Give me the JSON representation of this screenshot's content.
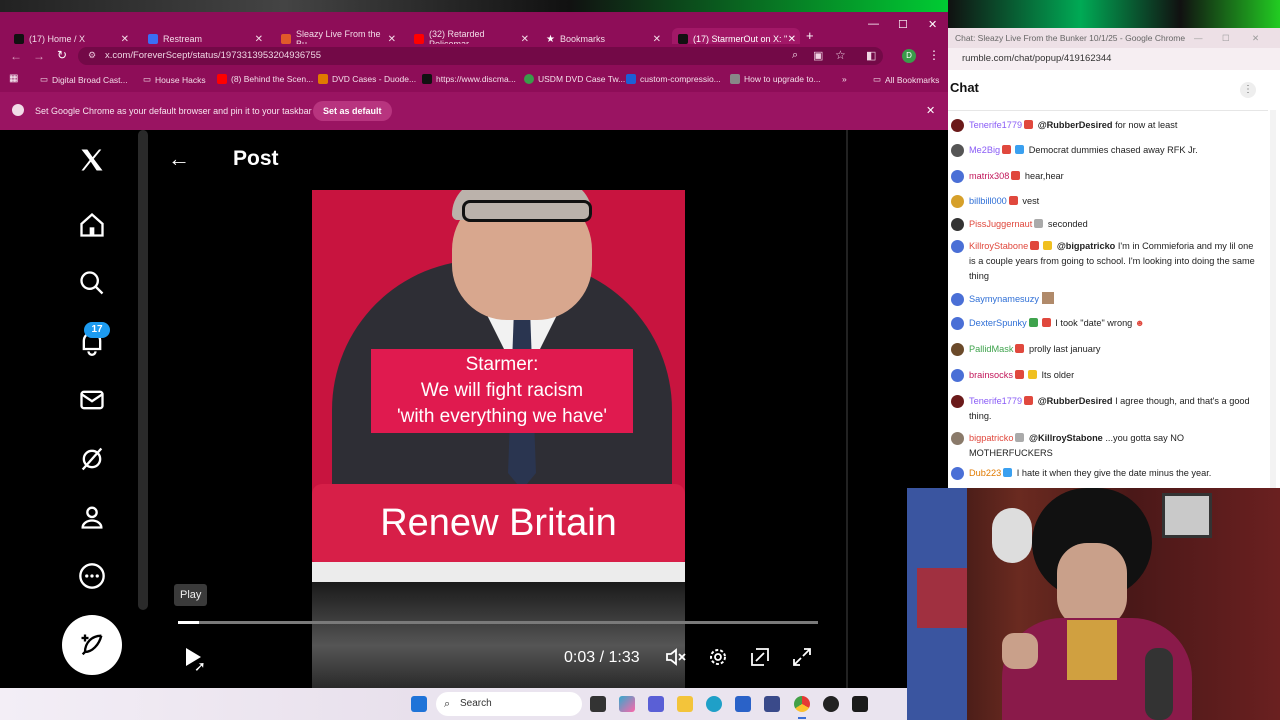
{
  "browser": {
    "tabs": [
      {
        "label": "(17) Home / X",
        "color": "#111111"
      },
      {
        "label": "Restream",
        "color": "#3b6ef5"
      },
      {
        "label": "Sleazy Live From the Bu",
        "color": "#e05a2a"
      },
      {
        "label": "(32) Retarded Policemar",
        "color": "#ff0000"
      },
      {
        "label": "Bookmarks",
        "color": "#ffffff"
      },
      {
        "label": "(17) StarmerOut on X: \"",
        "color": "#111111"
      }
    ],
    "new_tab": "+",
    "url": "x.com/ForeverScept/status/1973313953204936755",
    "bookmarks": [
      "Digital Broad Cast...",
      "House Hacks",
      "(8) Behind the Scen...",
      "DVD Cases - Duode...",
      "https://www.discma...",
      "USDM DVD Case Tw...",
      "custom-compressio...",
      "How to upgrade to..."
    ],
    "bookmarks_more": "»",
    "all_bookmarks": "All Bookmarks",
    "notice_text": "Set Google Chrome as your default browser and pin it to your taskbar",
    "notice_button": "Set as default",
    "accent": "#8e0d58"
  },
  "x": {
    "header": "Post",
    "notifications_count": "17",
    "video": {
      "caption": "Starmer:\nWe will fight racism\n'with everything we have'",
      "lectern_text": "Renew Britain",
      "tooltip": "Play",
      "time": "0:03 / 1:33",
      "progress": 0.033
    }
  },
  "chat": {
    "window_title": "Chat: Sleazy Live From the Bunker 10/1/25 - Google Chrome",
    "url": "rumble.com/chat/popup/419162344",
    "header": "Chat",
    "messages": [
      {
        "user": "Tenerife1779",
        "color": "#8a5cf6",
        "mention": "@RubberDesired",
        "text": "for now at least"
      },
      {
        "user": "Me2Big",
        "color": "#8a5cf6",
        "mention": "",
        "text": "Democrat dummies chased away RFK Jr."
      },
      {
        "user": "matrix308",
        "color": "#c2185b",
        "mention": "",
        "text": "hear,hear"
      },
      {
        "user": "billbill000",
        "color": "#2f6fd6",
        "mention": "",
        "text": "vest"
      },
      {
        "user": "PissJuggernaut",
        "color": "#e0483d",
        "mention": "",
        "text": "seconded"
      },
      {
        "user": "KillroyStabone",
        "color": "#e0483d",
        "mention": "@bigpatricko",
        "text": "I'm in Commieforia and my lil one is a couple years from going to school. I'm looking into doing the same thing"
      },
      {
        "user": "Saymynamesuzy",
        "color": "#2f6fd6",
        "mention": "",
        "text": ""
      },
      {
        "user": "DexterSpunky",
        "color": "#2f6fd6",
        "mention": "",
        "text": "I took \"date\" wrong"
      },
      {
        "user": "PallidMask",
        "color": "#3fa34d",
        "mention": "",
        "text": "prolly last january"
      },
      {
        "user": "brainsocks",
        "color": "#c2185b",
        "mention": "",
        "text": "Its older"
      },
      {
        "user": "Tenerife1779",
        "color": "#8a5cf6",
        "mention": "@RubberDesired",
        "text": "I agree though, and that's a good thing."
      },
      {
        "user": "bigpatricko",
        "color": "#e0483d",
        "mention": "@KillroyStabone",
        "text": "...you gotta say NO MOTHERFUCKERS"
      },
      {
        "user": "Dub223",
        "color": "#e07a00",
        "mention": "",
        "text": "I hate it when they give the date minus the year."
      }
    ]
  },
  "taskbar": {
    "search_placeholder": "Search"
  }
}
